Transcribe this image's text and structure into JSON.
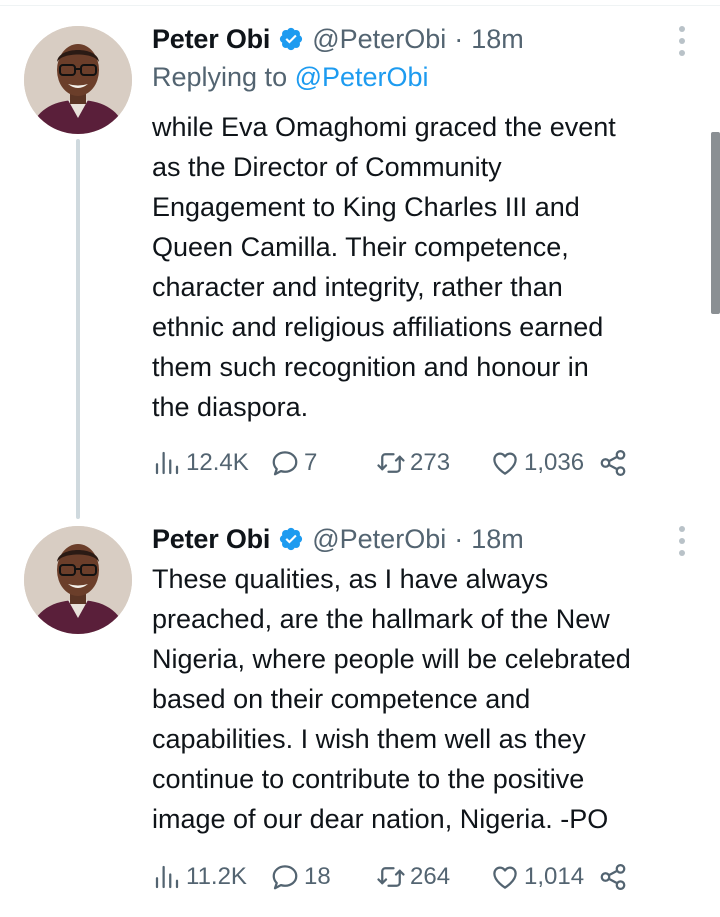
{
  "tweets": [
    {
      "author_name": "Peter Obi",
      "handle": "@PeterObi",
      "separator": "·",
      "time": "18m",
      "replying_prefix": "Replying to ",
      "replying_to": "@PeterObi",
      "text": "while Eva Omaghomi graced the event\nas the Director of Community\nEngagement to King Charles III and\nQueen Camilla. Their competence,\ncharacter and integrity, rather than\nethnic and religious affiliations earned\nthem such recognition and honour in\nthe diaspora.",
      "views": "12.4K",
      "replies": "7",
      "retweets": "273",
      "likes": "1,036"
    },
    {
      "author_name": "Peter Obi",
      "handle": "@PeterObi",
      "separator": "·",
      "time": "18m",
      "text": "These qualities, as I have always\npreached, are the hallmark of the New\nNigeria, where people will be celebrated\nbased on their competence and\ncapabilities. I wish them well as they\ncontinue to contribute to the positive\nimage of our dear nation, Nigeria. -PO",
      "views": "11.2K",
      "replies": "18",
      "retweets": "264",
      "likes": "1,014"
    }
  ],
  "icons": {
    "verified": "verified-badge-icon",
    "more": "more-vertical-icon",
    "views": "views-bar-chart-icon",
    "reply": "reply-bubble-icon",
    "retweet": "retweet-icon",
    "like": "heart-icon",
    "share": "share-icon"
  },
  "colors": {
    "verified": "#1d9bf0",
    "link": "#1d9bf0",
    "secondary_text": "#536471",
    "primary_text": "#0f1419",
    "thread_line": "#cfd9de"
  }
}
